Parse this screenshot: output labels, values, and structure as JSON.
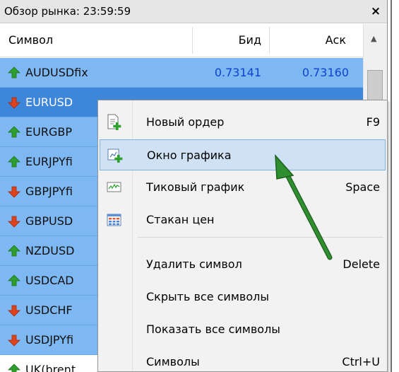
{
  "window": {
    "title": "Обзор рынка: 23:59:59",
    "close_label": "×"
  },
  "columns": {
    "symbol": "Символ",
    "bid": "Бид",
    "ask": "Аск"
  },
  "rows": [
    {
      "symbol": "AUDUSDfix",
      "bid": "0.73141",
      "ask": "0.73160",
      "dir": "up"
    },
    {
      "symbol": "EURUSD",
      "bid": "",
      "ask": "",
      "dir": "down"
    },
    {
      "symbol": "EURGBP",
      "bid": "",
      "ask": "",
      "dir": "up"
    },
    {
      "symbol": "EURJPYfi",
      "bid": "",
      "ask": "",
      "dir": "up"
    },
    {
      "symbol": "GBPJPYfi",
      "bid": "",
      "ask": "",
      "dir": "down"
    },
    {
      "symbol": "GBPUSD",
      "bid": "",
      "ask": "",
      "dir": "down"
    },
    {
      "symbol": "NZDUSD",
      "bid": "",
      "ask": "",
      "dir": "up"
    },
    {
      "symbol": "USDCAD",
      "bid": "",
      "ask": "",
      "dir": "up"
    },
    {
      "symbol": "USDCHF",
      "bid": "",
      "ask": "",
      "dir": "down"
    },
    {
      "symbol": "USDJPYfi",
      "bid": "",
      "ask": "",
      "dir": "down"
    },
    {
      "symbol": "UK(brent",
      "bid": "",
      "ask": "",
      "dir": "up"
    }
  ],
  "context_menu": {
    "items": [
      {
        "label": "Новый ордер",
        "shortcut": "F9",
        "icon": "new-order-icon"
      },
      {
        "label": "Окно графика",
        "shortcut": "",
        "icon": "chart-window-icon"
      },
      {
        "label": "Тиковый график",
        "shortcut": "Space",
        "icon": "tick-chart-icon"
      },
      {
        "label": "Стакан цен",
        "shortcut": "",
        "icon": "depth-of-market-icon"
      },
      {
        "label": "Удалить символ",
        "shortcut": "Delete",
        "icon": ""
      },
      {
        "label": "Скрыть все символы",
        "shortcut": "",
        "icon": ""
      },
      {
        "label": "Показать все символы",
        "shortcut": "",
        "icon": ""
      },
      {
        "label": "Символы",
        "shortcut": "Ctrl+U",
        "icon": ""
      }
    ]
  },
  "colors": {
    "row_bg": "#7eb8f3",
    "row_selected_bg": "#3e86da",
    "up_arrow": "#2e9e2e",
    "down_arrow": "#e0421c",
    "menu_highlight": "#cfe1f4",
    "pointer_arrow": "#2f8f2f"
  }
}
